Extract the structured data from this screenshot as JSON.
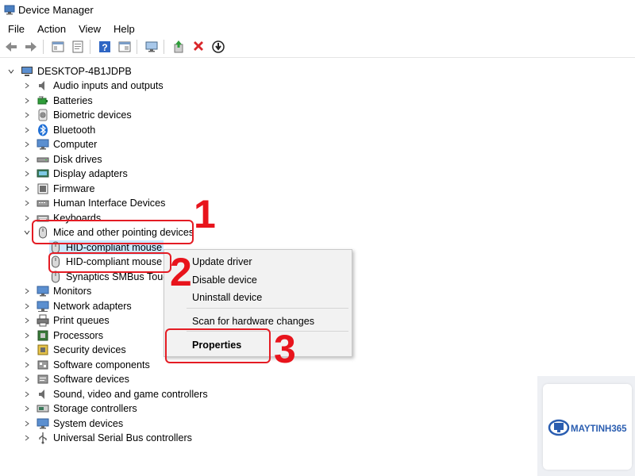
{
  "window": {
    "title": "Device Manager"
  },
  "menu": [
    "File",
    "Action",
    "View",
    "Help"
  ],
  "toolbar": [
    "back-icon",
    "forward-icon",
    "show-hide-console-tree-icon",
    "properties-sheet-icon",
    "help-icon",
    "console-view-icon",
    "monitor-scan-icon",
    "update-driver-icon",
    "uninstall-icon",
    "disable-device-icon"
  ],
  "tree": {
    "root": "DESKTOP-4B1JDPB",
    "categories": [
      "Audio inputs and outputs",
      "Batteries",
      "Biometric devices",
      "Bluetooth",
      "Computer",
      "Disk drives",
      "Display adapters",
      "Firmware",
      "Human Interface Devices",
      "Keyboards",
      "Mice and other pointing devices",
      "Monitors",
      "Network adapters",
      "Print queues",
      "Processors",
      "Security devices",
      "Software components",
      "Software devices",
      "Sound, video and game controllers",
      "Storage controllers",
      "System devices",
      "Universal Serial Bus controllers"
    ],
    "mice_children": [
      "HID-compliant mouse",
      "HID-compliant mouse",
      "Synaptics SMBus Touc"
    ]
  },
  "context_menu": {
    "update": "Update driver",
    "disable": "Disable device",
    "uninstall": "Uninstall device",
    "scan": "Scan for hardware changes",
    "properties": "Properties"
  },
  "annotations": {
    "one": "1",
    "two": "2",
    "three": "3"
  },
  "watermark": {
    "brand": "MAYTINH365"
  },
  "colors": {
    "annotation_red": "#e41c24",
    "selection_blue": "#cce8ff",
    "brand_blue": "#2a5db0"
  }
}
